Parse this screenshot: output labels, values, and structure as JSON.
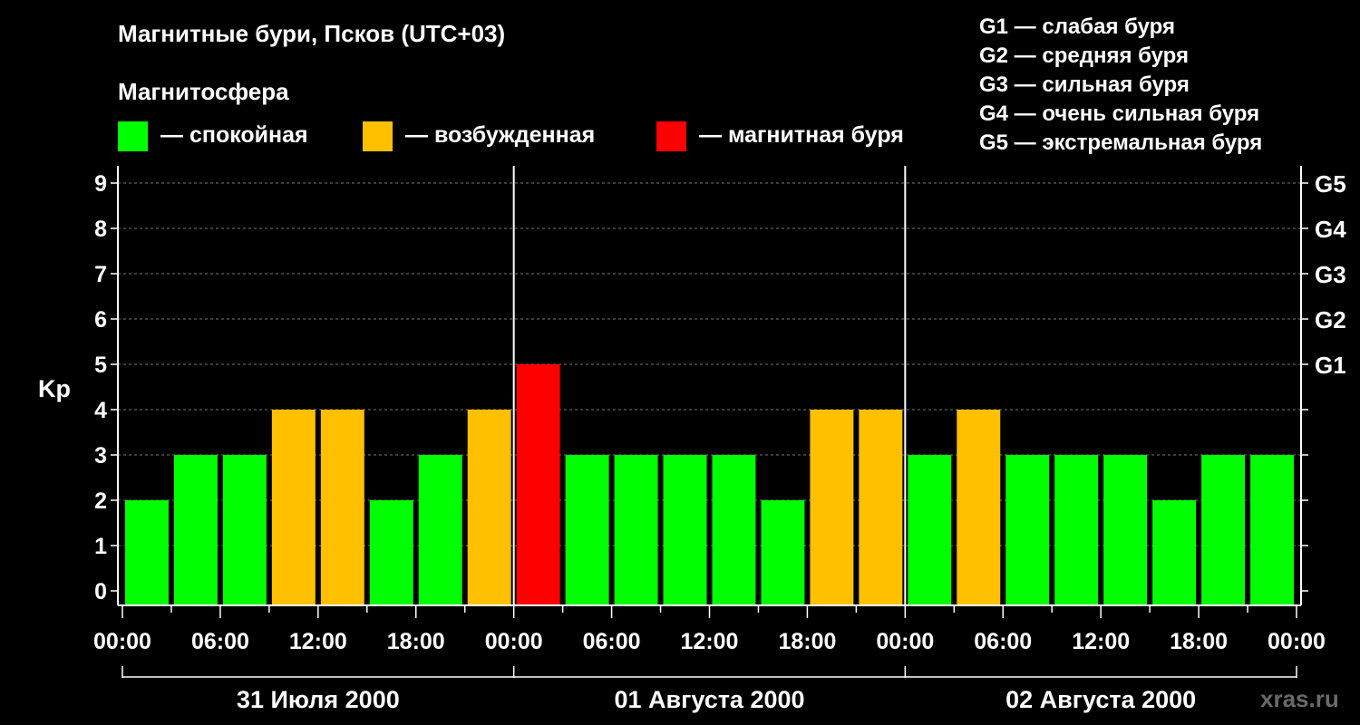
{
  "title": "Магнитные бури, Псков (UTC+03)",
  "legend": {
    "heading": "Магнитосфера",
    "items": [
      {
        "color": "#00ff00",
        "label": "— спокойная"
      },
      {
        "color": "#ffc000",
        "label": "— возбужденная"
      },
      {
        "color": "#ff0000",
        "label": "— магнитная буря"
      }
    ]
  },
  "g_scale": [
    "G1 — слабая буря",
    "G2 — средняя буря",
    "G3 — сильная буря",
    "G4 — очень сильная буря",
    "G5 — экстремальная буря"
  ],
  "watermark": "xras.ru",
  "chart_data": {
    "type": "bar",
    "ylabel": "Kp",
    "ylim": [
      0,
      9
    ],
    "y_ticks": [
      "0",
      "1",
      "2",
      "3",
      "4",
      "5",
      "6",
      "7",
      "8",
      "9"
    ],
    "g_ticks": [
      {
        "level": 5,
        "label": "G1"
      },
      {
        "level": 6,
        "label": "G2"
      },
      {
        "level": 7,
        "label": "G3"
      },
      {
        "level": 8,
        "label": "G4"
      },
      {
        "level": 9,
        "label": "G5"
      }
    ],
    "x_tick_labels": [
      "00:00",
      "06:00",
      "12:00",
      "18:00",
      "00:00",
      "06:00",
      "12:00",
      "18:00",
      "00:00",
      "06:00",
      "12:00",
      "18:00",
      "00:00"
    ],
    "days": [
      "31 Июля 2000",
      "01 Августа 2000",
      "02 Августа 2000"
    ],
    "grid": "horizontal dashed",
    "values": [
      2,
      3,
      3,
      4,
      4,
      2,
      3,
      4,
      5,
      3,
      3,
      3,
      3,
      2,
      4,
      4,
      3,
      4,
      3,
      3,
      3,
      2,
      3,
      3
    ],
    "colors": {
      "quiet": "#00ff00",
      "active": "#ffc000",
      "storm": "#ff0000"
    }
  }
}
